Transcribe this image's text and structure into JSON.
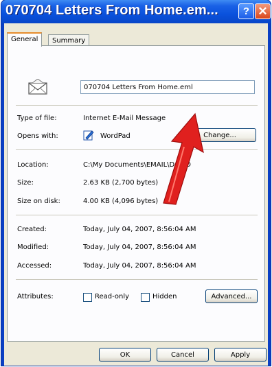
{
  "window": {
    "title": "070704 Letters From Home.em...",
    "help_label": "?",
    "close_label": "✕"
  },
  "tabs": [
    {
      "label": "General"
    },
    {
      "label": "Summary"
    }
  ],
  "file": {
    "name": "070704 Letters From Home.eml",
    "icon": "envelope-icon"
  },
  "fields": {
    "type_label": "Type of file:",
    "type_value": "Internet E-Mail Message",
    "opens_label": "Opens with:",
    "opens_value": "WordPad",
    "change_label": "Change...",
    "location_label": "Location:",
    "location_value": "C:\\My Documents\\EMAIL\\DA...D",
    "size_label": "Size:",
    "size_value": "2.63 KB (2,700 bytes)",
    "size_disk_label": "Size on disk:",
    "size_disk_value": "4.00 KB (4,096 bytes)",
    "created_label": "Created:",
    "created_value": "Today, July 04, 2007, 8:56:04 AM",
    "modified_label": "Modified:",
    "modified_value": "Today, July 04, 2007, 8:56:04 AM",
    "accessed_label": "Accessed:",
    "accessed_value": "Today, July 04, 2007, 8:56:04 AM",
    "attributes_label": "Attributes:",
    "readonly_label": "Read-only",
    "hidden_label": "Hidden",
    "advanced_label": "Advanced..."
  },
  "buttons": {
    "ok": "OK",
    "cancel": "Cancel",
    "apply": "Apply"
  },
  "colors": {
    "titlebar": "#0a52dd",
    "arrow": "#e0201e"
  }
}
